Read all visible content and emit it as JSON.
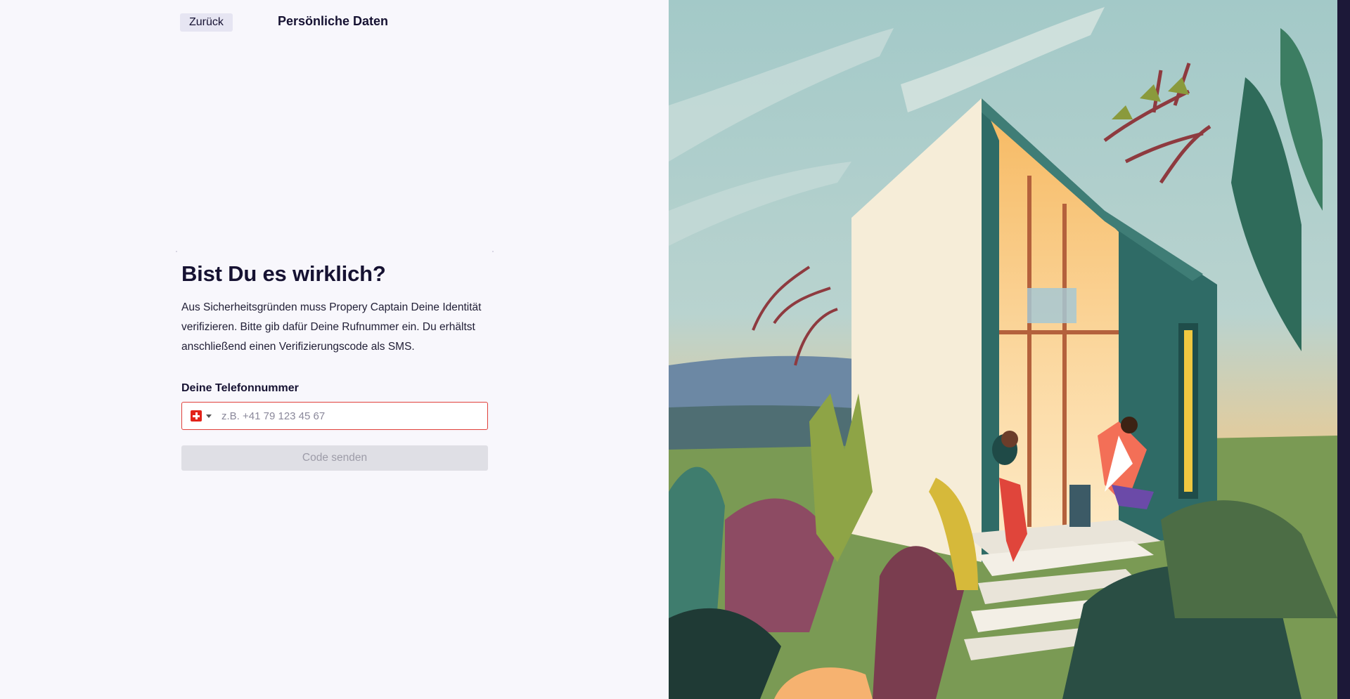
{
  "header": {
    "back_label": "Zurück",
    "title": "Persönliche Daten"
  },
  "main": {
    "heading": "Bist Du es wirklich?",
    "description": "Aus Sicherheitsgründen muss Propery Captain Deine Identität verifizieren. Bitte gib dafür Deine Rufnummer ein. Du erhältst anschließend einen Verifizierungscode als SMS.",
    "phone_label": "Deine Telefonnummer",
    "phone_value": "",
    "phone_placeholder": "z.B. +41 79 123 45 67",
    "country_icon": "flag-switzerland-icon",
    "send_label": "Code senden"
  },
  "illustration": {
    "subject": "modern house with two people relaxing on porch"
  },
  "colors": {
    "background": "#f8f7fc",
    "text": "#161232",
    "error_border": "#e0403a",
    "disabled_button": "#dfdfe5"
  }
}
